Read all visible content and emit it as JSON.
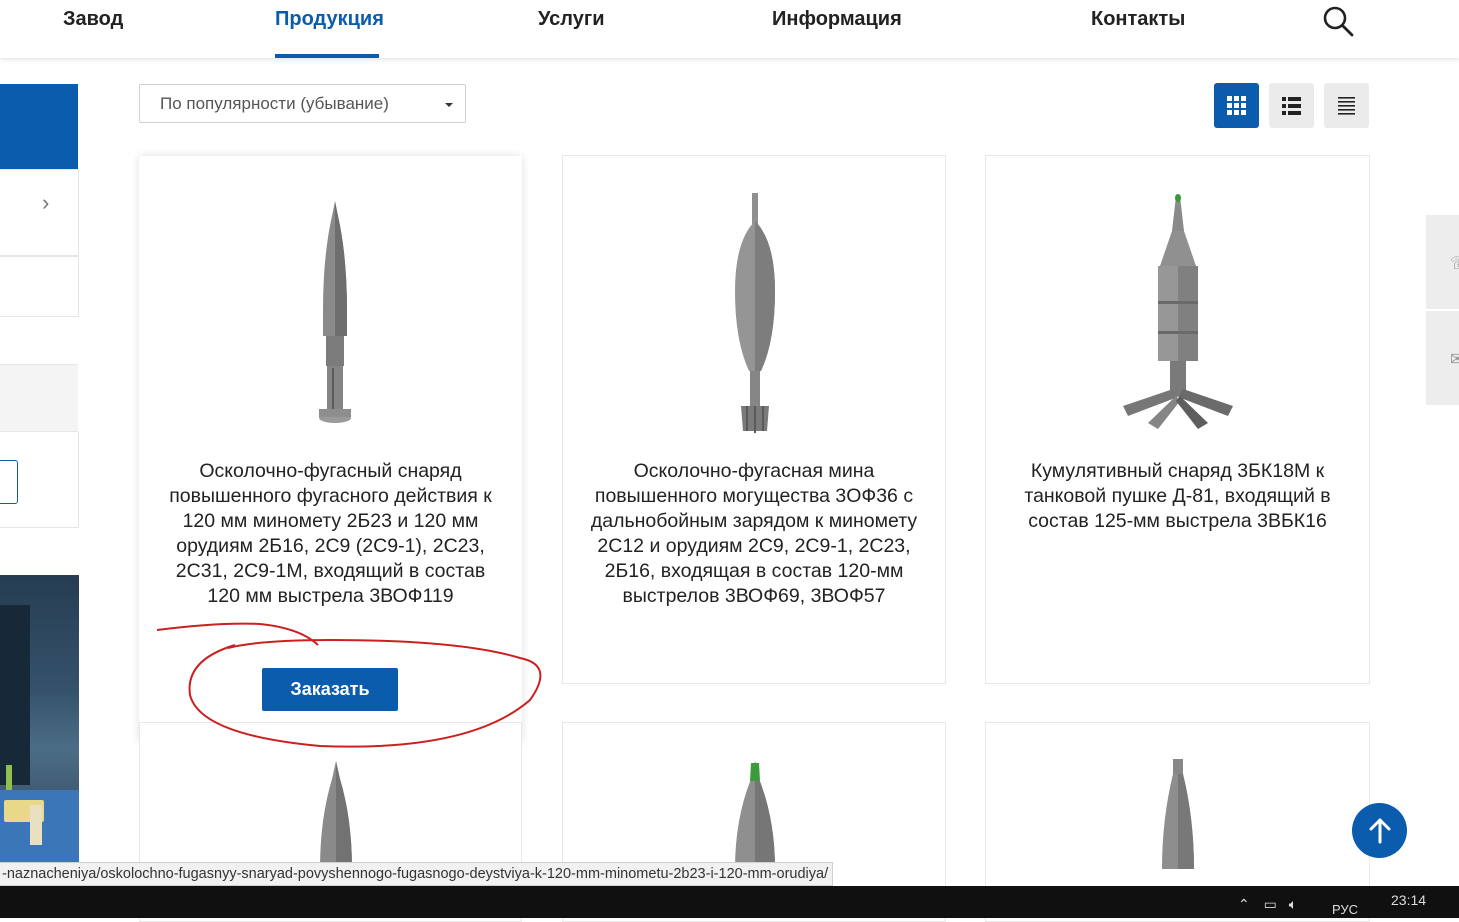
{
  "nav": {
    "items": [
      {
        "label": "Завод"
      },
      {
        "label": "Продукция",
        "active": true
      },
      {
        "label": "Услуги"
      },
      {
        "label": "Информация"
      },
      {
        "label": "Контакты"
      }
    ],
    "search_icon": "search-icon",
    "accent_color": "#0b5cad"
  },
  "sort": {
    "selected": "По популярности (убывание)"
  },
  "view_modes": [
    {
      "icon": "grid-view-icon",
      "active": true
    },
    {
      "icon": "list-view-icon",
      "active": false
    },
    {
      "icon": "compact-list-icon",
      "active": false
    }
  ],
  "products": [
    {
      "title": "Осколочно-фугасный снаряд повышенного фугасного действия к 120 мм миномету 2Б23 и 120 мм орудиям 2Б16, 2С9 (2С9-1), 2С23, 2С31, 2С9-1М, входящий в состав 120 мм выстрела 3ВОФ119",
      "order_label": "Заказать"
    },
    {
      "title": "Осколочно-фугасная мина повышенного могущества 3ОФ36 с дальнобойным зарядом к миномету 2С12 и орудиям 2С9, 2С9-1, 2С23, 2Б16, входящая в состав 120-мм выстрелов 3ВОФ69, 3ВОФ57"
    },
    {
      "title": "Кумулятивный снаряд 3БК18М к танковой пушке Д-81, входящий в состав 125-мм выстрела 3ВБК16"
    }
  ],
  "status_url": "-naznacheniya/oskolochno-fugasnyy-snaryad-povyshennogo-fugasnogo-deystviya-k-120-mm-minometu-2b23-i-120-mm-orudiya/",
  "taskbar": {
    "lang": "РУС",
    "time": "23:14"
  }
}
